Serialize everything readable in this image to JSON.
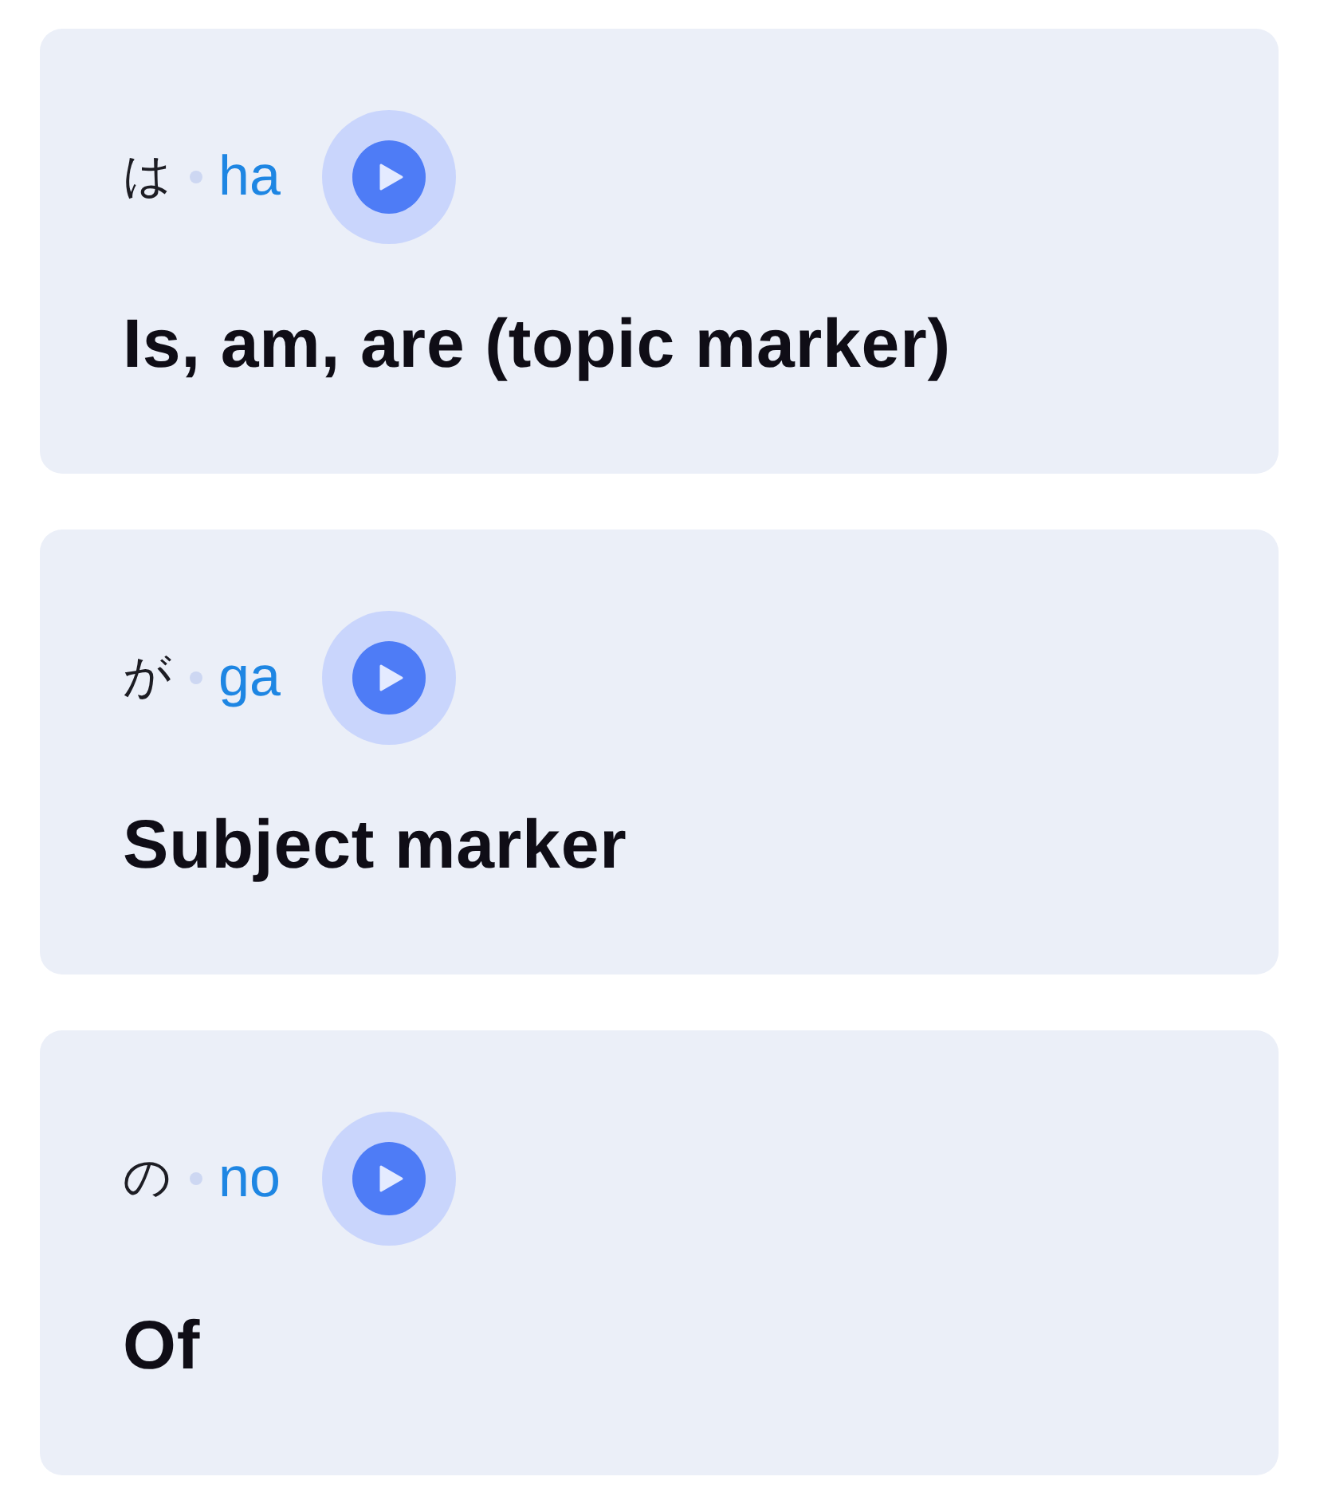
{
  "cards": [
    {
      "kana": "は",
      "romaji": "ha",
      "meaning": "Is, am, are (topic marker)"
    },
    {
      "kana": "が",
      "romaji": "ga",
      "meaning": "Subject marker"
    },
    {
      "kana": "の",
      "romaji": "no",
      "meaning": "Of"
    }
  ]
}
